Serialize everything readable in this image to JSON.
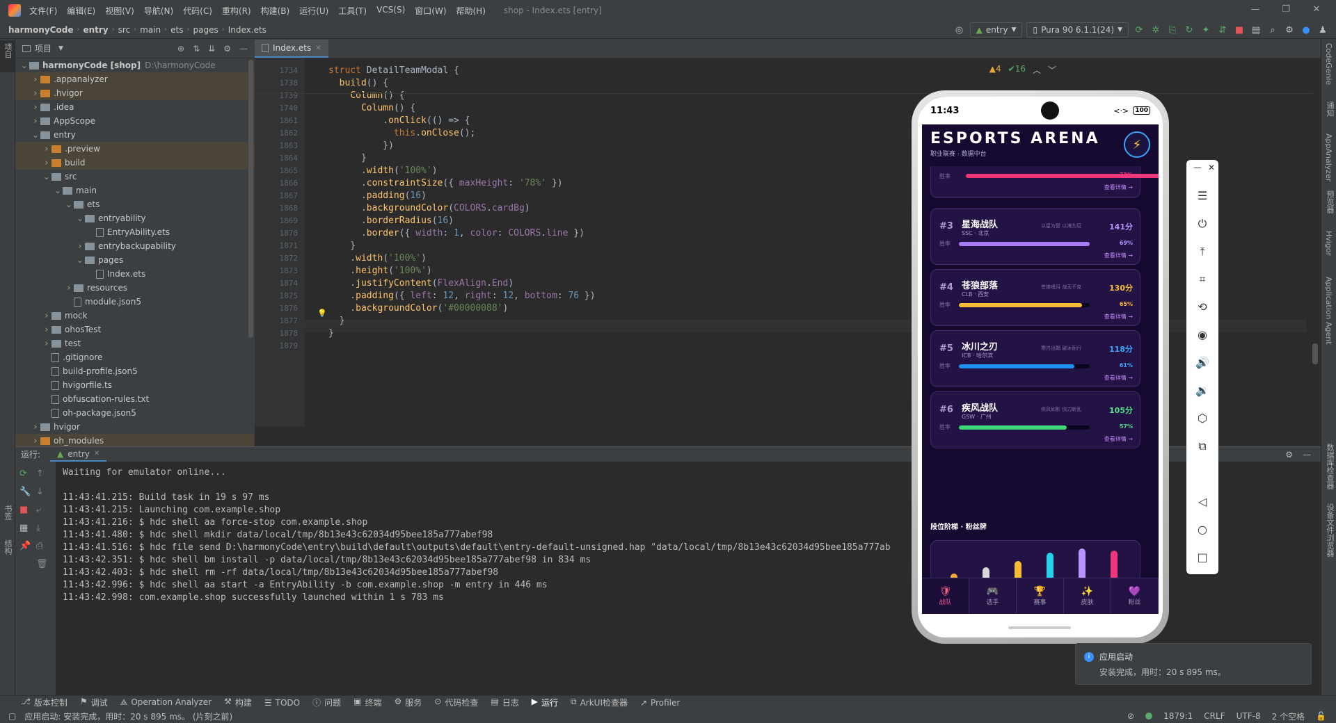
{
  "menu": {
    "items": [
      "文件(F)",
      "编辑(E)",
      "视图(V)",
      "导航(N)",
      "代码(C)",
      "重构(R)",
      "构建(B)",
      "运行(U)",
      "工具(T)",
      "VCS(S)",
      "窗口(W)",
      "帮助(H)"
    ],
    "window_title": "shop - Index.ets [entry]"
  },
  "breadcrumb": [
    "harmonyCode",
    "entry",
    "src",
    "main",
    "ets",
    "pages",
    "Index.ets"
  ],
  "toolbar": {
    "module": "entry",
    "device": "Pura 90 6.1.1(24)"
  },
  "left_strip": {
    "project": "项目",
    "bookmarks": "书签",
    "structure": "结构"
  },
  "right_strip": [
    "CodeGenie",
    "通知",
    "AppAnalyzer",
    "预览器",
    "Hvigor",
    "Application Agent",
    "数据库检查器",
    "设备文件浏览器"
  ],
  "project": {
    "title": "项目",
    "tree": [
      {
        "depth": 0,
        "label": "harmonyCode [shop]",
        "extra": "D:\\harmonyCode",
        "kind": "folder",
        "open": true
      },
      {
        "depth": 1,
        "label": ".appanalyzer",
        "kind": "folder-orange",
        "open": false
      },
      {
        "depth": 1,
        "label": ".hvigor",
        "kind": "folder-orange",
        "open": false
      },
      {
        "depth": 1,
        "label": ".idea",
        "kind": "folder",
        "open": false
      },
      {
        "depth": 1,
        "label": "AppScope",
        "kind": "folder",
        "open": false
      },
      {
        "depth": 1,
        "label": "entry",
        "kind": "folder",
        "open": true
      },
      {
        "depth": 2,
        "label": ".preview",
        "kind": "folder-orange",
        "open": false
      },
      {
        "depth": 2,
        "label": "build",
        "kind": "folder-orange",
        "open": false
      },
      {
        "depth": 2,
        "label": "src",
        "kind": "folder",
        "open": true
      },
      {
        "depth": 3,
        "label": "main",
        "kind": "folder",
        "open": true
      },
      {
        "depth": 4,
        "label": "ets",
        "kind": "folder",
        "open": true
      },
      {
        "depth": 5,
        "label": "entryability",
        "kind": "folder",
        "open": true
      },
      {
        "depth": 6,
        "label": "EntryAbility.ets",
        "kind": "file"
      },
      {
        "depth": 5,
        "label": "entrybackupability",
        "kind": "folder",
        "open": false
      },
      {
        "depth": 5,
        "label": "pages",
        "kind": "folder",
        "open": true
      },
      {
        "depth": 6,
        "label": "Index.ets",
        "kind": "file"
      },
      {
        "depth": 4,
        "label": "resources",
        "kind": "folder",
        "open": false
      },
      {
        "depth": 4,
        "label": "module.json5",
        "kind": "file"
      },
      {
        "depth": 2,
        "label": "mock",
        "kind": "folder",
        "open": false
      },
      {
        "depth": 2,
        "label": "ohosTest",
        "kind": "folder",
        "open": false
      },
      {
        "depth": 2,
        "label": "test",
        "kind": "folder",
        "open": false
      },
      {
        "depth": 2,
        "label": ".gitignore",
        "kind": "file"
      },
      {
        "depth": 2,
        "label": "build-profile.json5",
        "kind": "file"
      },
      {
        "depth": 2,
        "label": "hvigorfile.ts",
        "kind": "file"
      },
      {
        "depth": 2,
        "label": "obfuscation-rules.txt",
        "kind": "file"
      },
      {
        "depth": 2,
        "label": "oh-package.json5",
        "kind": "file"
      },
      {
        "depth": 1,
        "label": "hvigor",
        "kind": "folder",
        "open": false
      },
      {
        "depth": 1,
        "label": "oh_modules",
        "kind": "folder-orange",
        "open": false
      }
    ]
  },
  "editor": {
    "tab": "Index.ets",
    "inspections": {
      "warnings": "4",
      "ok": "16"
    },
    "lines": [
      {
        "n": "1734",
        "html": "<span class='kw'>struct</span> <span style='color:#a9b7c6'>DetailTeamModal</span> {"
      },
      {
        "n": "1738",
        "html": "  <span class='fn'>build</span>() {"
      },
      {
        "n": "1739",
        "html": "    <span class='fn'>Column</span>() {"
      },
      {
        "n": "1740",
        "html": "      <span class='fn'>Column</span>() {"
      },
      {
        "n": "1861",
        "html": "          .<span class='fn'>onClick</span>(() => {"
      },
      {
        "n": "1862",
        "html": "            <span class='kw'>this</span>.<span class='fn'>onClose</span>();"
      },
      {
        "n": "1863",
        "html": "          })"
      },
      {
        "n": "1864",
        "html": "      }"
      },
      {
        "n": "1865",
        "html": "      .<span class='fn'>width</span>(<span class='st'>'100%'</span>)"
      },
      {
        "n": "1866",
        "html": "      .<span class='fn'>constraintSize</span>({ <span class='pr'>maxHeight</span>: <span class='st'>'78%'</span> })"
      },
      {
        "n": "1867",
        "html": "      .<span class='fn'>padding</span>(<span class='nm'>16</span>)"
      },
      {
        "n": "1868",
        "html": "      .<span class='fn'>backgroundColor</span>(<span class='pr'>COLORS</span>.<span class='pr'>cardBg</span>)"
      },
      {
        "n": "1869",
        "html": "      .<span class='fn'>borderRadius</span>(<span class='nm'>16</span>)"
      },
      {
        "n": "1870",
        "html": "      .<span class='fn'>border</span>({ <span class='pr'>width</span>: <span class='nm'>1</span>, <span class='pr'>color</span>: <span class='pr'>COLORS</span>.<span class='pr'>line</span> })"
      },
      {
        "n": "1871",
        "html": "    }"
      },
      {
        "n": "1872",
        "html": "    .<span class='fn'>width</span>(<span class='st'>'100%'</span>)"
      },
      {
        "n": "1873",
        "html": "    .<span class='fn'>height</span>(<span class='st'>'100%'</span>)"
      },
      {
        "n": "1874",
        "html": "    .<span class='fn'>justifyContent</span>(<span class='pr'>FlexAlign</span>.<span class='pr'>End</span>)"
      },
      {
        "n": "1875",
        "html": "    .<span class='fn'>padding</span>({ <span class='pr'>left</span>: <span class='nm'>12</span>, <span class='pr'>right</span>: <span class='nm'>12</span>, <span class='pr'>bottom</span>: <span class='nm'>76</span> })"
      },
      {
        "n": "1876",
        "html": "    .<span class='fn'>backgroundColor</span>(<span class='st'>'#00000088'</span>)"
      },
      {
        "n": "1877",
        "html": "  }"
      },
      {
        "n": "1878",
        "html": "}"
      },
      {
        "n": "1879",
        "html": ""
      }
    ]
  },
  "run": {
    "label": "运行:",
    "tab": "entry",
    "log": [
      "Waiting for emulator online...",
      "",
      "11:43:41.215: Build task in 19 s 97 ms",
      "11:43:41.215: Launching com.example.shop",
      "11:43:41.216: $ hdc shell aa force-stop com.example.shop",
      "11:43:41.480: $ hdc shell mkdir data/local/tmp/8b13e43c62034d95bee185a777abef98",
      "11:43:41.516: $ hdc file send D:\\harmonyCode\\entry\\build\\default\\outputs\\default\\entry-default-unsigned.hap \"data/local/tmp/8b13e43c62034d95bee185a777ab",
      "11:43:42.351: $ hdc shell bm install -p data/local/tmp/8b13e43c62034d95bee185a777abef98 in 834 ms",
      "11:43:42.403: $ hdc shell rm -rf data/local/tmp/8b13e43c62034d95bee185a777abef98",
      "11:43:42.996: $ hdc shell aa start -a EntryAbility -b com.example.shop -m entry in 446 ms",
      "11:43:42.998: com.example.shop successfully launched within 1 s 783 ms"
    ]
  },
  "bottom_tools": [
    "版本控制",
    "调试",
    "Operation Analyzer",
    "构建",
    "TODO",
    "问题",
    "终端",
    "服务",
    "代码检查",
    "日志",
    "运行",
    "ArkUI检查器",
    "Profiler"
  ],
  "status": {
    "message": "应用启动: 安装完成，用时：20 s 895 ms。 (片刻之前)",
    "position": "1879:1",
    "line_sep": "CRLF",
    "encoding": "UTF-8",
    "indent": "2 个空格"
  },
  "toast": {
    "title": "应用启动",
    "body": "安装完成，用时：20 s 895 ms。"
  },
  "phone": {
    "time": "11:43",
    "battery": "100",
    "app_title": "ESPORTS ARENA",
    "app_subtitle": "职业联赛 · 数据中台",
    "partial_top": {
      "rate": "72%",
      "link": "查看详情 →",
      "color": "#f0367a",
      "rate_num": 72
    },
    "teams": [
      {
        "rank": "#3",
        "name": "星海战队",
        "code": "SSC · 北京",
        "slogan": "以星为誓 以海为证",
        "score": "141分",
        "rate": "69%",
        "rate_num": 69,
        "color": "#a77bf3",
        "score_color": "#b993ff"
      },
      {
        "rank": "#4",
        "name": "苍狼部落",
        "code": "CLB · 西安",
        "slogan": "苍狼嗜月 战无不克",
        "score": "130分",
        "rate": "65%",
        "rate_num": 65,
        "color": "#f7bc36",
        "score_color": "#f7bc36"
      },
      {
        "rank": "#5",
        "name": "冰川之刃",
        "code": "ICB · 哈尔滨",
        "slogan": "寒刃出鞘 破冰而行",
        "score": "118分",
        "rate": "61%",
        "rate_num": 61,
        "color": "#1f8ff0",
        "score_color": "#3aa5ff"
      },
      {
        "rank": "#6",
        "name": "疾风战队",
        "code": "GSW · 广州",
        "slogan": "疾风如影 快刀斩乱",
        "score": "105分",
        "rate": "57%",
        "rate_num": 57,
        "color": "#3fd47c",
        "score_color": "#4fe38c"
      }
    ],
    "rate_label": "胜率",
    "detail_link": "查看详情 →",
    "section_title": "段位阶梯 · 粉丝牌",
    "tabs": [
      {
        "icon": "🛡",
        "label": "战队"
      },
      {
        "icon": "🎮",
        "label": "选手"
      },
      {
        "icon": "🏆",
        "label": "赛事"
      },
      {
        "icon": "✨",
        "label": "皮肤"
      },
      {
        "icon": "💜",
        "label": "粉丝"
      }
    ],
    "ladder": [
      {
        "color": "#f7a63d",
        "level": 0.05
      },
      {
        "color": "#d8d8d8",
        "level": 0.2
      },
      {
        "color": "#f7bc36",
        "level": 0.35
      },
      {
        "color": "#24d3e8",
        "level": 0.55
      },
      {
        "color": "#b993ff",
        "level": 0.65
      },
      {
        "color": "#f0367a",
        "level": 0.6
      }
    ]
  }
}
